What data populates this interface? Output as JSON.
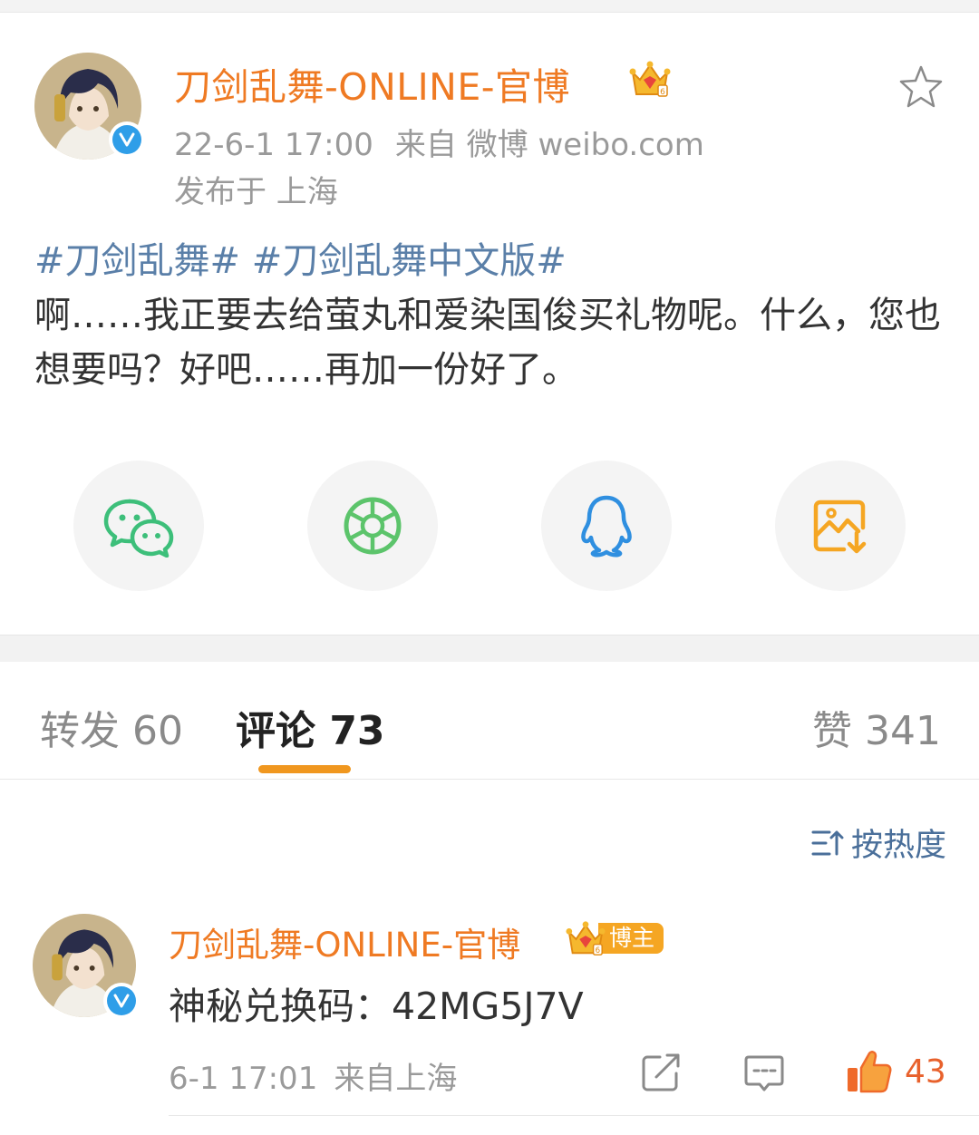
{
  "post": {
    "author": "刀剑乱舞-ONLINE-官博",
    "time": "22-6-1 17:00",
    "source": "来自 微博 weibo.com",
    "location": "发布于 上海",
    "hashtags": [
      "#刀剑乱舞#",
      "#刀剑乱舞中文版#"
    ],
    "text": "啊……我正要去给萤丸和爱染国俊买礼物呢。什么，您也想要吗？好吧……再加一份好了。"
  },
  "share": {
    "items": [
      "wechat-icon",
      "moments-icon",
      "qq-icon",
      "save-image-icon"
    ],
    "colors": {
      "wechat": "#3dbf7a",
      "moments": "#5cc46b",
      "qq": "#2f8fe0",
      "save": "#f5a623"
    }
  },
  "tabs": {
    "repost": "转发 60",
    "comment": "评论 73",
    "like": "赞 341"
  },
  "sort": {
    "label": "按热度"
  },
  "comment": {
    "author": "刀剑乱舞-ONLINE-官博",
    "badge": "博主",
    "text": "神秘兑换码：42MG5J7V",
    "time": "6-1 17:01",
    "source": "来自上海",
    "likes": "43"
  },
  "colors": {
    "accent": "#ef7a23",
    "link": "#5a7fa8",
    "tab_indicator": "#f0971f",
    "like": "#e8612c",
    "verified": "#2f9ee8"
  }
}
